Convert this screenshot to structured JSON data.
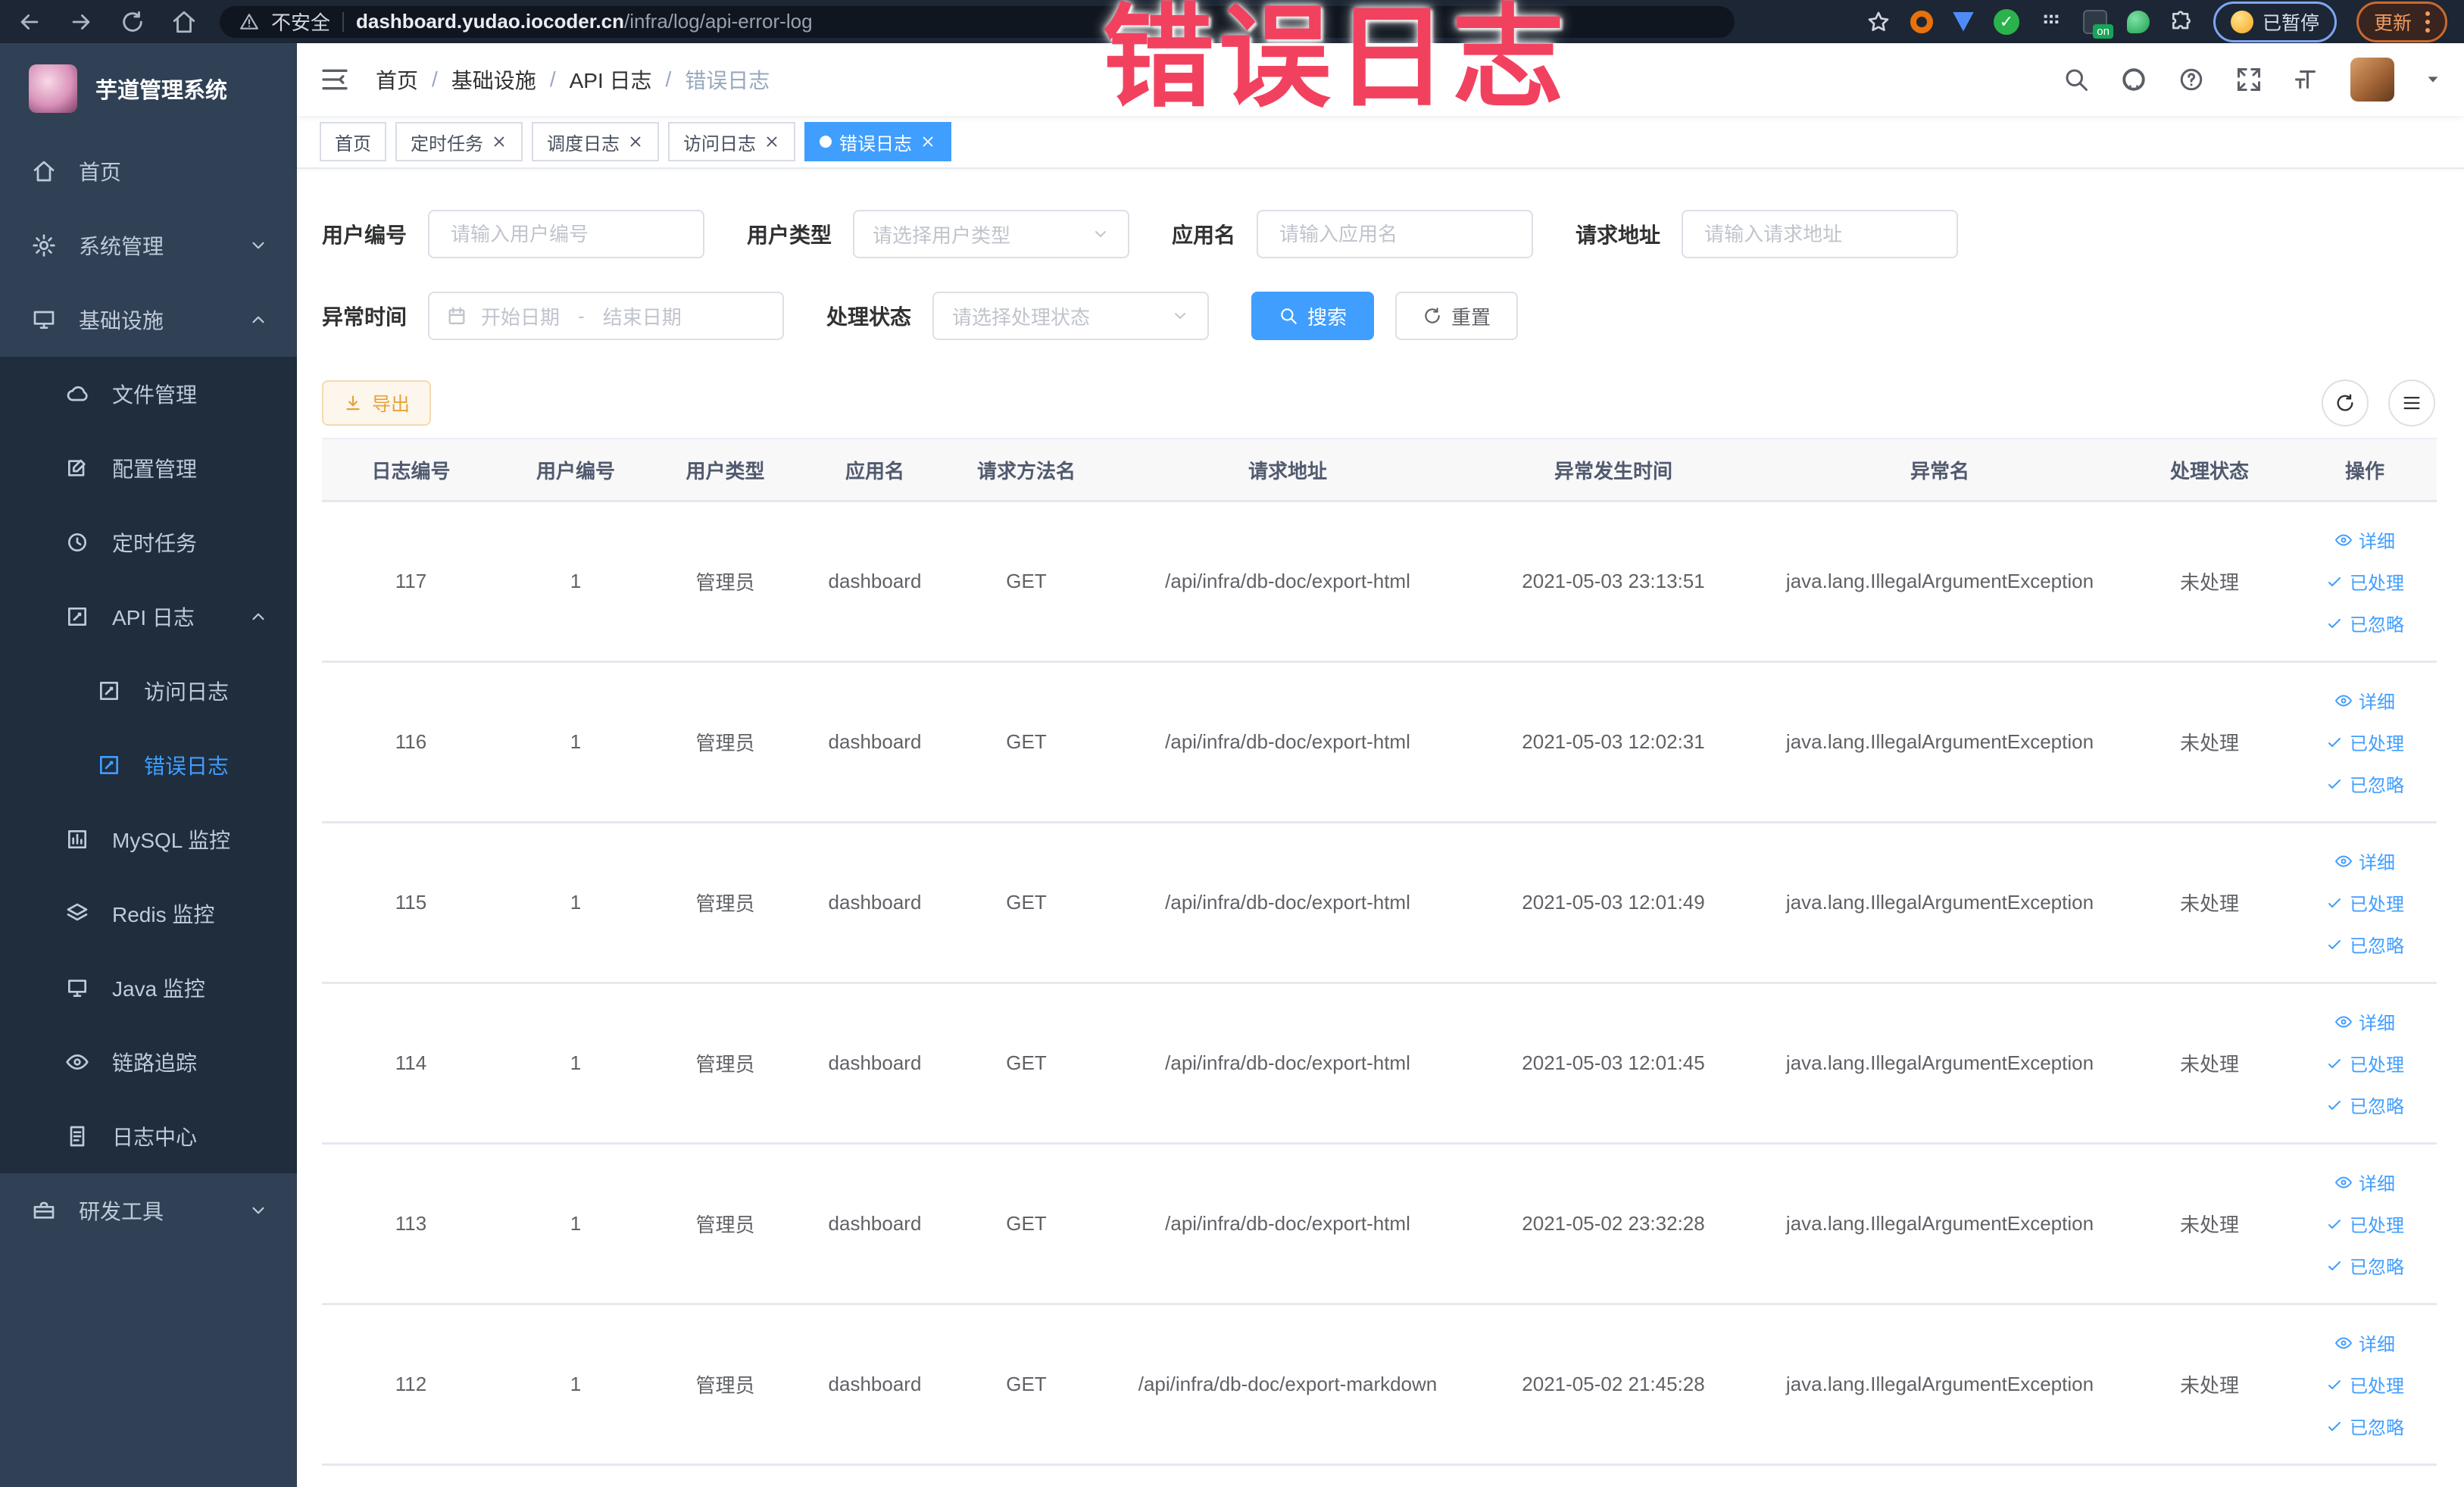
{
  "browser": {
    "security_label": "不安全",
    "url_domain": "dashboard.yudao.iocoder.cn",
    "url_path": "/infra/log/api-error-log",
    "paused_label": "已暂停",
    "update_label": "更新",
    "extensions": [
      "bookmark-star-icon",
      "ext-orange-icon",
      "ext-location-icon",
      "ext-check-icon",
      "ext-grid-icon",
      "ext-on-icon",
      "ext-leaf-icon",
      "puzzle-icon"
    ]
  },
  "watermark": "错误日志",
  "sidebar": {
    "title": "芋道管理系统",
    "items": [
      {
        "label": "首页",
        "icon": "home",
        "level": 1
      },
      {
        "label": "系统管理",
        "icon": "gear",
        "level": 1,
        "chevron": "down"
      },
      {
        "label": "基础设施",
        "icon": "monitor",
        "level": 1,
        "chevron": "up"
      },
      {
        "label": "文件管理",
        "icon": "cloud",
        "level": 2,
        "submenu": true
      },
      {
        "label": "配置管理",
        "icon": "edit",
        "level": 2,
        "submenu": true
      },
      {
        "label": "定时任务",
        "icon": "clock",
        "level": 2,
        "submenu": true
      },
      {
        "label": "API 日志",
        "icon": "log",
        "level": 2,
        "chevron": "up",
        "submenu": true
      },
      {
        "label": "访问日志",
        "icon": "log",
        "level": 3,
        "submenu": true
      },
      {
        "label": "错误日志",
        "icon": "log",
        "level": 3,
        "submenu": true,
        "active": true
      },
      {
        "label": "MySQL 监控",
        "icon": "chart",
        "level": 2,
        "submenu": true
      },
      {
        "label": "Redis 监控",
        "icon": "layers",
        "level": 2,
        "submenu": true
      },
      {
        "label": "Java 监控",
        "icon": "java",
        "level": 2,
        "submenu": true
      },
      {
        "label": "链路追踪",
        "icon": "eye",
        "level": 2,
        "submenu": true
      },
      {
        "label": "日志中心",
        "icon": "doc",
        "level": 2,
        "submenu": true
      },
      {
        "label": "研发工具",
        "icon": "tools",
        "level": 1,
        "chevron": "down"
      }
    ]
  },
  "breadcrumb": [
    "首页",
    "基础设施",
    "API 日志",
    "错误日志"
  ],
  "tabs": [
    {
      "label": "首页",
      "closable": false,
      "active": false
    },
    {
      "label": "定时任务",
      "closable": true,
      "active": false
    },
    {
      "label": "调度日志",
      "closable": true,
      "active": false
    },
    {
      "label": "访问日志",
      "closable": true,
      "active": false
    },
    {
      "label": "错误日志",
      "closable": true,
      "active": true
    }
  ],
  "filters": {
    "user_id": {
      "label": "用户编号",
      "placeholder": "请输入用户编号"
    },
    "user_type": {
      "label": "用户类型",
      "placeholder": "请选择用户类型"
    },
    "app_name": {
      "label": "应用名",
      "placeholder": "请输入应用名"
    },
    "request_url": {
      "label": "请求地址",
      "placeholder": "请输入请求地址"
    },
    "exception_time": {
      "label": "异常时间",
      "start_placeholder": "开始日期",
      "separator": "-",
      "end_placeholder": "结束日期"
    },
    "process_status": {
      "label": "处理状态",
      "placeholder": "请选择处理状态"
    },
    "search_label": "搜索",
    "reset_label": "重置"
  },
  "toolbar": {
    "export_label": "导出"
  },
  "table": {
    "columns": [
      "日志编号",
      "用户编号",
      "用户类型",
      "应用名",
      "请求方法名",
      "请求地址",
      "异常发生时间",
      "异常名",
      "处理状态",
      "操作"
    ],
    "actions": [
      {
        "label": "详细",
        "icon": "eye",
        "name": "detail-action-link"
      },
      {
        "label": "已处理",
        "icon": "check",
        "name": "processed-action-link"
      },
      {
        "label": "已忽略",
        "icon": "check",
        "name": "ignored-action-link"
      }
    ],
    "rows": [
      {
        "log_id": "117",
        "user_id": "1",
        "user_type": "管理员",
        "app_name": "dashboard",
        "method": "GET",
        "url": "/api/infra/db-doc/export-html",
        "time": "2021-05-03 23:13:51",
        "exception": "java.lang.IllegalArgumentException",
        "status": "未处理"
      },
      {
        "log_id": "116",
        "user_id": "1",
        "user_type": "管理员",
        "app_name": "dashboard",
        "method": "GET",
        "url": "/api/infra/db-doc/export-html",
        "time": "2021-05-03 12:02:31",
        "exception": "java.lang.IllegalArgumentException",
        "status": "未处理"
      },
      {
        "log_id": "115",
        "user_id": "1",
        "user_type": "管理员",
        "app_name": "dashboard",
        "method": "GET",
        "url": "/api/infra/db-doc/export-html",
        "time": "2021-05-03 12:01:49",
        "exception": "java.lang.IllegalArgumentException",
        "status": "未处理"
      },
      {
        "log_id": "114",
        "user_id": "1",
        "user_type": "管理员",
        "app_name": "dashboard",
        "method": "GET",
        "url": "/api/infra/db-doc/export-html",
        "time": "2021-05-03 12:01:45",
        "exception": "java.lang.IllegalArgumentException",
        "status": "未处理"
      },
      {
        "log_id": "113",
        "user_id": "1",
        "user_type": "管理员",
        "app_name": "dashboard",
        "method": "GET",
        "url": "/api/infra/db-doc/export-html",
        "time": "2021-05-02 23:32:28",
        "exception": "java.lang.IllegalArgumentException",
        "status": "未处理"
      },
      {
        "log_id": "112",
        "user_id": "1",
        "user_type": "管理员",
        "app_name": "dashboard",
        "method": "GET",
        "url": "/api/infra/db-doc/export-markdown",
        "time": "2021-05-02 21:45:28",
        "exception": "java.lang.IllegalArgumentException",
        "status": "未处理"
      }
    ]
  },
  "colors": {
    "primary": "#409eff",
    "warning": "#e6a23c",
    "watermark_pink": "#f2415f",
    "sidebar_bg": "#304156",
    "submenu_bg": "#1f2d3d",
    "chrome_bg": "#1d2634",
    "table_header_bg": "#f8f8f9",
    "border": "#ebeef5"
  }
}
